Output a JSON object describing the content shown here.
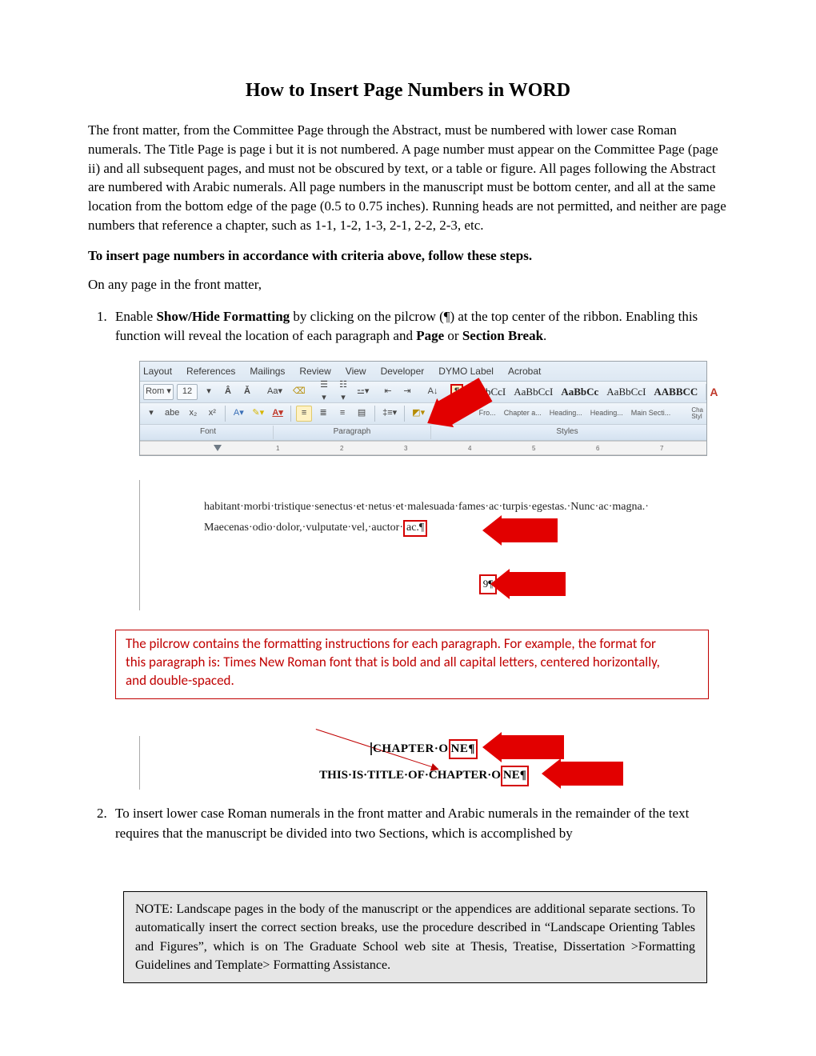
{
  "title": "How to Insert Page Numbers in WORD",
  "intro": "The front matter, from the Committee Page through the Abstract, must be numbered with lower case Roman numerals. The Title Page is page i but it is not numbered. A page number must appear on the Committee Page (page ii) and all subsequent pages, and must not be obscured by text, or a table or figure. All pages following the Abstract are numbered with Arabic numerals. All page numbers in the manuscript must be bottom center, and all at the same location from the bottom edge of the page (0.5 to 0.75 inches). Running heads are not permitted, and neither are page numbers that reference a chapter, such as 1-1, 1-2, 1-3, 2-1, 2-2, 2-3, etc.",
  "steps_intro": "To insert page numbers in accordance with criteria above, follow these steps.",
  "front_matter_line": "On any page in the front matter,",
  "step1_pre": "Enable ",
  "step1_bold": "Show/Hide Formatting",
  "step1_mid": " by clicking on the pilcrow (¶) at the top center of the ribbon. Enabling this function will reveal the location of each paragraph and ",
  "step1_bold2": "Page",
  "step1_or": " or ",
  "step1_bold3": "Section Break",
  "step1_end": ".",
  "ribbon": {
    "tabs": [
      "Layout",
      "References",
      "Mailings",
      "Review",
      "View",
      "Developer",
      "DYMO Label",
      "Acrobat"
    ],
    "font_name": "Rom",
    "font_size": "12",
    "pilcrow": "¶",
    "styles": [
      {
        "sample": "AaBbCcI",
        "label": "Fro..."
      },
      {
        "sample": "AaBbCcI",
        "label": "Chapter a..."
      },
      {
        "sample": "AaBbCc",
        "label": "Heading..."
      },
      {
        "sample": "AaBbCcI",
        "label": "Heading..."
      },
      {
        "sample": "AABBCC",
        "label": "Main Secti..."
      }
    ],
    "groups": [
      "Font",
      "Paragraph",
      "Styles"
    ],
    "change_styles": "Cha\nStyl"
  },
  "doc_sample": {
    "line1": "habitant·morbi·tristique·senectus·et·netus·et·malesuada·fames·ac·turpis·egestas.·Nunc·ac·magna.·",
    "line2_text": "Maecenas·odio·dolor,·vulputate·vel,·auctor·",
    "line2_endbox": "ac.¶",
    "pagenum": "9¶"
  },
  "callout": {
    "l1": "The pilcrow contains the formatting instructions for each paragraph. For example, the format for",
    "l2": "this paragraph is:  Times New Roman font that is bold and all capital letters, centered horizontally,",
    "l3": "and double-spaced."
  },
  "chapter": {
    "line1_pre": "CHAPTER·O",
    "line1_box": "NE¶",
    "line2_pre": "THIS·IS·TITLE·OF·CHAPTER·O",
    "line2_box": "NE¶"
  },
  "step2": "To insert lower case Roman numerals in the front matter and Arabic numerals in the remainder of the text requires that the manuscript be divided into two Sections, which is accomplished by",
  "note": "NOTE: Landscape pages in the body of the manuscript or the appendices are additional separate sections. To automatically insert the correct section breaks, use the procedure described in “Landscape Orienting Tables and Figures”, which is on The Graduate School web site at Thesis, Treatise, Dissertation >Formatting Guidelines and Template> Formatting Assistance."
}
